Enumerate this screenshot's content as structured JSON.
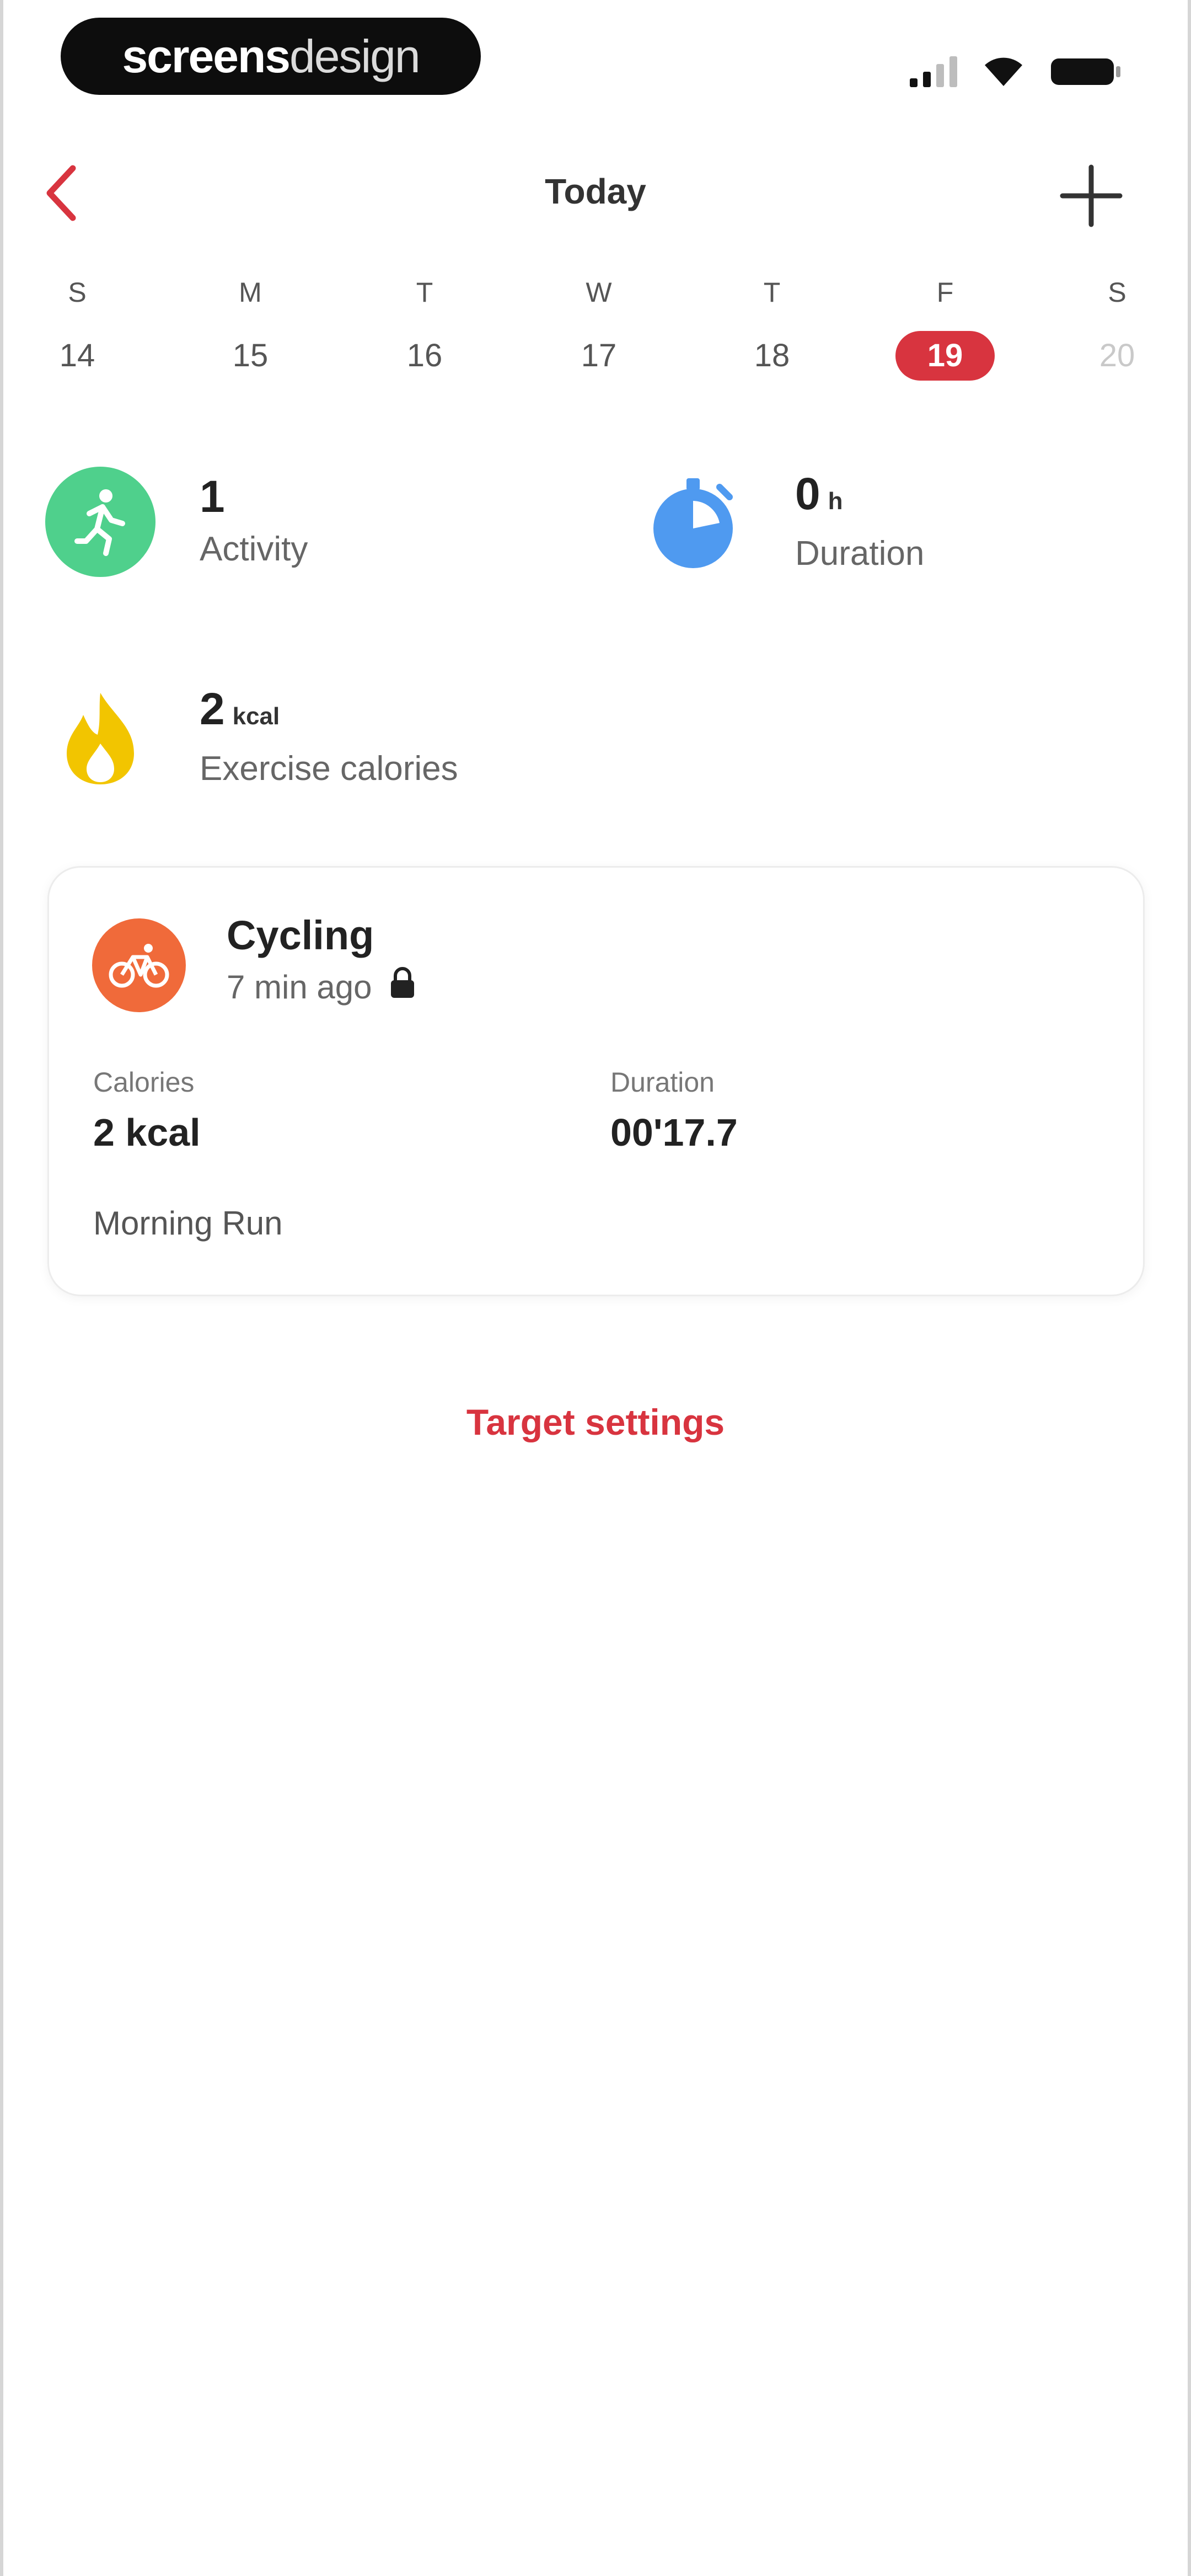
{
  "status_bar": {
    "brand": {
      "bold": "screens",
      "light": "design"
    },
    "icons": [
      "cellular-signal-icon",
      "wifi-icon",
      "battery-icon"
    ]
  },
  "nav": {
    "title": "Today",
    "back_icon": "chevron-left-icon",
    "add_icon": "plus-icon"
  },
  "week": {
    "days": [
      {
        "letter": "S",
        "number": "14"
      },
      {
        "letter": "M",
        "number": "15"
      },
      {
        "letter": "T",
        "number": "16"
      },
      {
        "letter": "W",
        "number": "17"
      },
      {
        "letter": "T",
        "number": "18"
      },
      {
        "letter": "F",
        "number": "19"
      },
      {
        "letter": "S",
        "number": "20"
      }
    ],
    "selected_index": 5
  },
  "stats": {
    "activity": {
      "value": "1",
      "unit": "",
      "label": "Activity",
      "icon": "running-figure-icon",
      "color": "#4fd08c"
    },
    "duration": {
      "value": "0",
      "unit": "h",
      "label": "Duration",
      "icon": "stopwatch-icon",
      "color": "#4f9af0"
    },
    "calories": {
      "value": "2",
      "unit": "kcal",
      "label": "Exercise calories",
      "icon": "flame-icon",
      "color": "#f2c500"
    }
  },
  "activity_card": {
    "title": "Cycling",
    "time_ago": "7 min ago",
    "icon": "bicycle-icon",
    "icon_color": "#f06a3a",
    "calories_label": "Calories",
    "calories_value": "2 kcal",
    "duration_label": "Duration",
    "duration_value": "00'17.7",
    "note": "Morning Run"
  },
  "target_settings_label": "Target settings",
  "accent_color": "#d8343f"
}
